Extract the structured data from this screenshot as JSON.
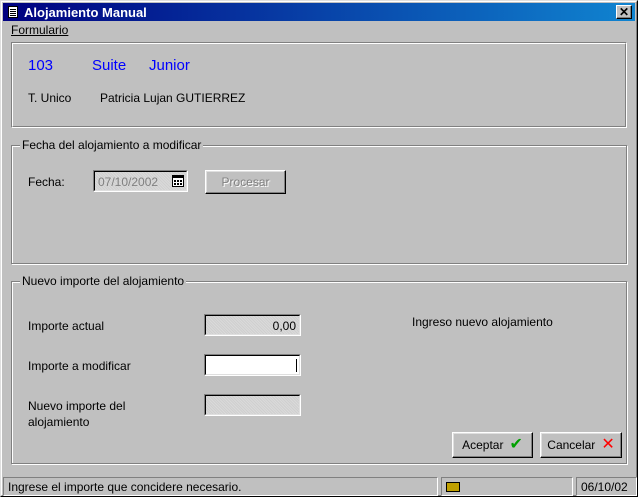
{
  "window": {
    "title": "Alojamiento Manual",
    "close_glyph": "✕"
  },
  "menu": {
    "items": [
      {
        "label": "Formulario"
      }
    ]
  },
  "header": {
    "room_number": "103",
    "room_type_1": "Suite",
    "room_type_2": "Junior",
    "tariff": "T. Unico",
    "guest_name": "Patricia Lujan  GUTIERREZ"
  },
  "date_group": {
    "legend": "Fecha del alojamiento a modificar",
    "date_label": "Fecha:",
    "date_value": "07/10/2002",
    "process_label": "Procesar"
  },
  "amount_group": {
    "legend": "Nuevo importe del alojamiento",
    "current_label": "Importe actual",
    "current_value": "0,00",
    "modify_label": "Importe a modificar",
    "modify_value": "",
    "new_label_line1": "Nuevo importe del",
    "new_label_line2": "alojamiento",
    "new_value": "",
    "info_text": "Ingreso nuevo alojamiento",
    "accept_label": "Aceptar",
    "cancel_label": "Cancelar"
  },
  "statusbar": {
    "message": "Ingrese el importe que concidere necesario.",
    "icon": "keyboard-icon",
    "date": "06/10/02"
  },
  "colors": {
    "title_bar": "#000080",
    "accent_text": "#0000ff",
    "face": "#c0c0c0",
    "accept_icon": "#00a000",
    "cancel_icon": "#ff0000"
  }
}
